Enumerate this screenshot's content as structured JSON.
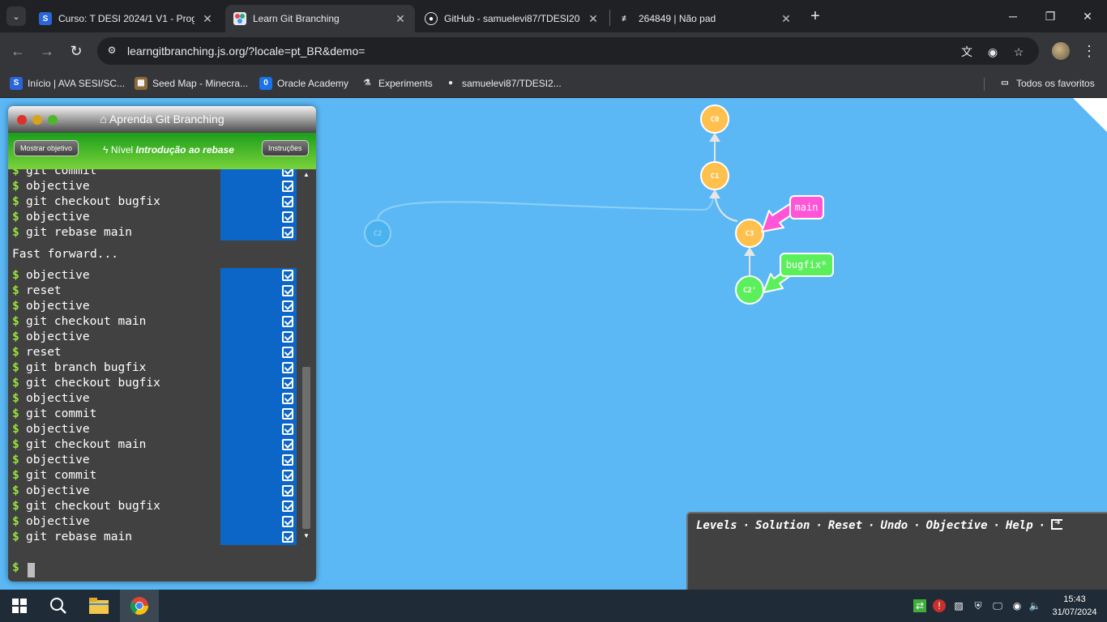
{
  "browser": {
    "tabs": [
      {
        "title": "Curso: T DESI 2024/1 V1 - Progr",
        "favicon": "S",
        "active": false
      },
      {
        "title": "Learn Git Branching",
        "favicon": "git",
        "active": true
      },
      {
        "title": "GitHub - samuelevi87/TDESI202",
        "favicon": "github",
        "active": false
      },
      {
        "title": "264849 | Não pad",
        "favicon": "note",
        "active": false
      }
    ],
    "url": "learngitbranching.js.org/?locale=pt_BR&demo=",
    "bookmarks": [
      {
        "label": "Início | AVA SESI/SC...",
        "icon": "S"
      },
      {
        "label": "Seed Map - Minecra...",
        "icon": "seed"
      },
      {
        "label": "Oracle Academy",
        "icon": "0"
      },
      {
        "label": "Experiments",
        "icon": "flask"
      },
      {
        "label": "samuelevi87/TDESI2...",
        "icon": "github"
      }
    ],
    "all_bookmarks": "Todos os favoritos"
  },
  "terminal": {
    "title": "Aprenda Git Branching",
    "show_goal": "Mostrar objetivo",
    "level_prefix": "Nível",
    "level_name": "Introdução ao rebase",
    "instructions": "Instruções",
    "prompt": "$",
    "commands_top": [
      "git commit",
      "objective",
      "git checkout bugfix",
      "objective",
      "git rebase main"
    ],
    "fast_forward": "Fast forward...",
    "commands_bottom": [
      "objective",
      "reset",
      "objective",
      "git checkout main",
      "objective",
      "reset",
      "git branch bugfix",
      "git checkout bugfix",
      "objective",
      "git commit",
      "objective",
      "git checkout main",
      "objective",
      "git commit",
      "objective",
      "git checkout bugfix",
      "objective",
      "git rebase main"
    ]
  },
  "graph": {
    "commits": [
      "C0",
      "C1",
      "C2",
      "C3",
      "C2'"
    ],
    "branches": [
      "main",
      "bugfix*"
    ],
    "colors": {
      "main": "#ff55d6",
      "bugfix": "#5bf05b",
      "commit": "#ffc04d",
      "ghost": "#4ab2ee"
    }
  },
  "command_bar": {
    "links": [
      "Levels",
      "Solution",
      "Reset",
      "Undo",
      "Objective",
      "Help"
    ],
    "separator": "·"
  },
  "taskbar": {
    "time": "15:43",
    "date": "31/07/2024"
  }
}
